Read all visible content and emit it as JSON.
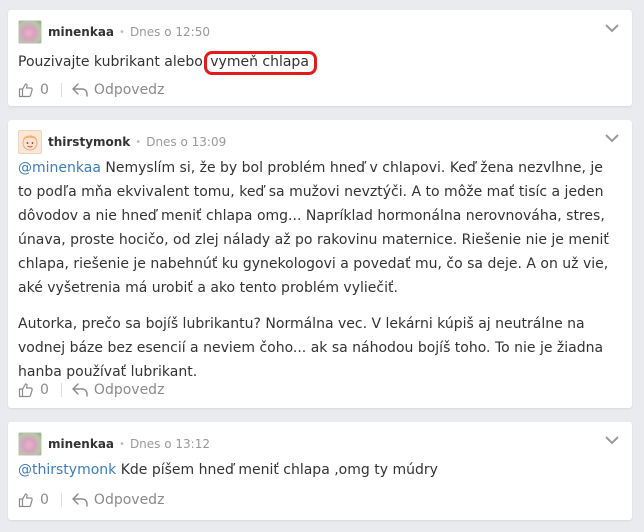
{
  "comments": [
    {
      "username": "minenkaa",
      "time": "Dnes o 12:50",
      "text_before": "Pouzivajte kubrikant alebo ",
      "text_highlight": "vymeň chlapa",
      "likes": "0",
      "reply_label": "Odpovedz"
    },
    {
      "username": "thirstymonk",
      "time": "Dnes o 13:09",
      "mention": "@minenkaa",
      "paragraph1": " Nemyslím si, že by bol problém hneď v chlapovi. Keď žena nezvlhne, je to podľa mňa ekvivalent tomu, keď sa mužovi nevztýči. A to môže mať tisíc a jeden dôvodov a nie hneď meniť chlapa omg... Napríklad hormonálna nerovnováha, stres, únava, proste hocičo, od zlej nálady až po rakovinu maternice. Riešenie nie je meniť chlapa, riešenie je nabehnúť ku gynekologovi a povedať mu, čo sa deje. A on už vie, aké vyšetrenia má urobiť a ako tento problém vyliečiť.",
      "paragraph2": "Autorka, prečo sa bojíš lubrikantu? Normálna vec. V lekárni kúpiš aj neutrálne na vodnej báze bez esencií a neviem čoho... ak sa náhodou bojíš toho. To nie je žiadna hanba používať lubrikant.",
      "likes": "0",
      "reply_label": "Odpovedz"
    },
    {
      "username": "minenkaa",
      "time": "Dnes o 13:12",
      "mention": "@thirstymonk",
      "text": " Kde píšem hneď meniť chlapa ,omg ty múdry",
      "likes": "0",
      "reply_label": "Odpovedz"
    }
  ],
  "icons": {
    "like": "thumbs-up-icon",
    "reply": "reply-arrow-icon",
    "menu": "chevron-down-icon"
  },
  "colors": {
    "mention": "#3b7cbf",
    "highlight_circle": "#e21b1b",
    "muted": "#8a8a8a"
  }
}
